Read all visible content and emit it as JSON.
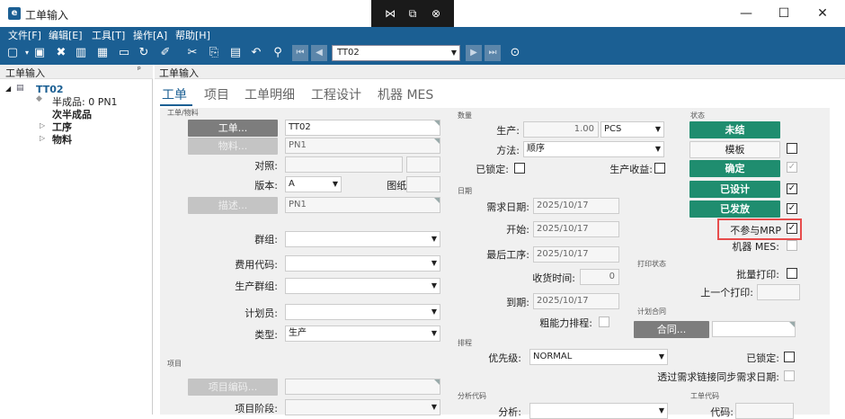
{
  "window": {
    "title": "工单输入",
    "icon": "e"
  },
  "remote": {
    "icons": [
      "pin-icon",
      "restore-icon",
      "close-circle-icon"
    ]
  },
  "window_controls": {
    "minimize": "—",
    "maximize": "☐",
    "close": "✕"
  },
  "menu": [
    "文件[F]",
    "编辑[E]",
    "工具[T]",
    "操作[A]",
    "帮助[H]"
  ],
  "toolbar": {
    "record": "TT02"
  },
  "left_panel": {
    "title": "工单输入",
    "pin": "ᵖ"
  },
  "tree": {
    "root": "TT02",
    "semi": "半成品: 0 PN1",
    "sub": "次半成品",
    "process": "工序",
    "material": "物料"
  },
  "right_panel": {
    "title": "工单输入"
  },
  "tabs": [
    "工单",
    "项目",
    "工单明细",
    "工程设计",
    "机器 MES"
  ],
  "sections": {
    "order": "工单/物料",
    "project": "项目",
    "qty": "数量",
    "date": "日期",
    "sched": "排程",
    "analysis": "分析代码",
    "status": "状态",
    "print": "打印状态",
    "contract": "计划合同",
    "work": "工单代码"
  },
  "order": {
    "btn_order": "工单...",
    "order_no": "TT02",
    "btn_item": "物料...",
    "item": "PN1",
    "ref_label": "对照:",
    "ver_label": "版本:",
    "version": "A",
    "drawing_label": "图纸:",
    "btn_desc": "描述...",
    "desc": "PN1",
    "group_label": "群组:",
    "cost_label": "费用代码:",
    "prodgroup_label": "生产群组:",
    "planner_label": "计划员:",
    "type_label": "类型:",
    "type": "生产"
  },
  "project": {
    "btn_code": "项目编码...",
    "phase_label": "项目阶段:"
  },
  "qty": {
    "prod_label": "生产:",
    "prod_qty": "1.00",
    "unit": "PCS",
    "method_label": "方法:",
    "method": "顺序",
    "locked_label": "已锁定:",
    "income_label": "生产收益:"
  },
  "date": {
    "req_label": "需求日期:",
    "req": "2025/10/17",
    "start_label": "开始:",
    "start": "2025/10/17",
    "last_label": "最后工序:",
    "last": "2025/10/17",
    "recv_label": "收货时间:",
    "recv": "0",
    "due_label": "到期:",
    "due": "2025/10/17",
    "cap_label": "粗能力排程:"
  },
  "sched": {
    "prio_label": "优先级:",
    "prio": "NORMAL",
    "locked_label": "已锁定:",
    "sync_label": "透过需求链接同步需求日期:"
  },
  "analysis": {
    "label": "分析:"
  },
  "status": {
    "open": "未结",
    "template": "模板",
    "confirm": "确定",
    "designed": "已设计",
    "released": "已发放",
    "no_mrp": "不参与MRP",
    "mes": "机器 MES:"
  },
  "print": {
    "batch_label": "批量打印:",
    "last_label": "上一个打印:"
  },
  "contract": {
    "btn": "合同..."
  },
  "work": {
    "code_label": "代码:"
  },
  "colors": {
    "accent": "#1b5f93",
    "status_green": "#1f8d6f",
    "highlight": "#e74c4c"
  }
}
